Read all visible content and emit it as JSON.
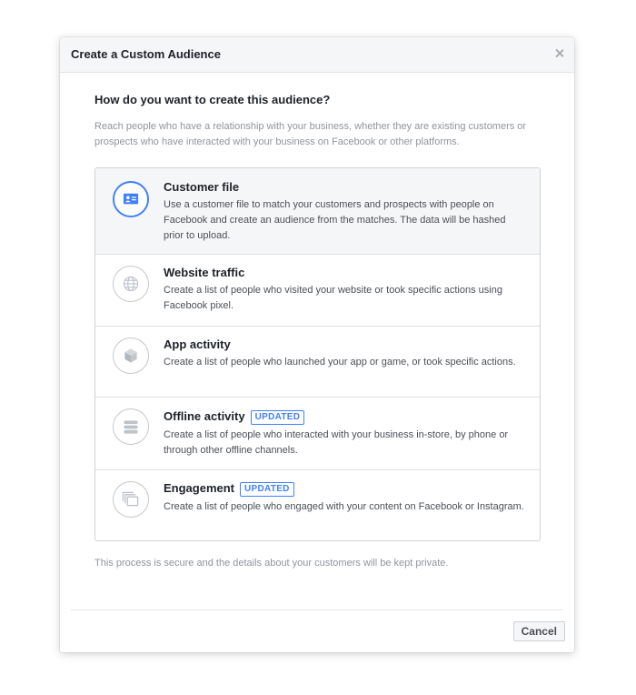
{
  "dialog": {
    "title": "Create a Custom Audience",
    "question": "How do you want to create this audience?",
    "intro": "Reach people who have a relationship with your business, whether they are existing customers or prospects who have interacted with your business on Facebook or other platforms.",
    "footnote": "This process is secure and the details about your customers will be kept private.",
    "cancel_label": "Cancel"
  },
  "options": [
    {
      "title": "Customer file",
      "description": "Use a customer file to match your customers and prospects with people on Facebook and create an audience from the matches. The data will be hashed prior to upload.",
      "icon": "contact-card-icon",
      "selected": true
    },
    {
      "title": "Website traffic",
      "description": "Create a list of people who visited your website or took specific actions using Facebook pixel.",
      "icon": "globe-icon"
    },
    {
      "title": "App activity",
      "description": "Create a list of people who launched your app or game, or took specific actions.",
      "icon": "cube-icon"
    },
    {
      "title": "Offline activity",
      "badge": "UPDATED",
      "description": "Create a list of people who interacted with your business in-store, by phone or through other offline channels.",
      "icon": "stack-icon"
    },
    {
      "title": "Engagement",
      "badge": "UPDATED",
      "description": "Create a list of people who engaged with your content on Facebook or Instagram.",
      "icon": "layered-pages-icon"
    }
  ],
  "colors": {
    "accent": "#4080ff",
    "selected_background": "#f5f6f7",
    "muted_text": "#90949c"
  }
}
